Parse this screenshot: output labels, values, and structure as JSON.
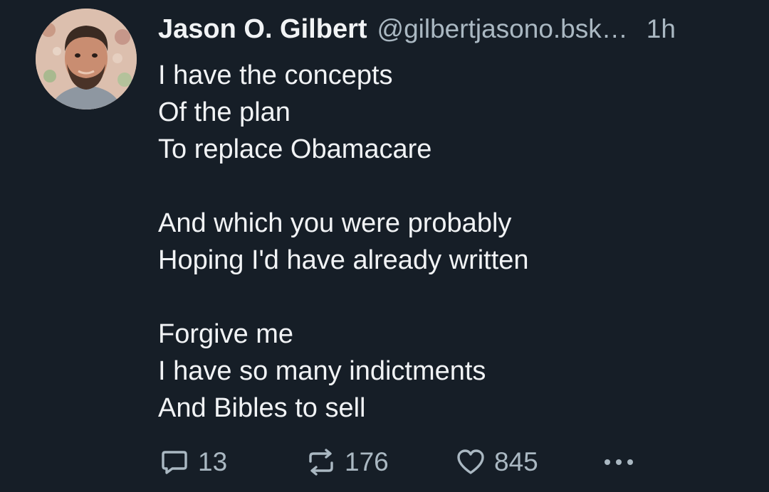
{
  "author": {
    "display_name": "Jason O. Gilbert",
    "handle": "@gilbertjasono.bsk…",
    "time_ago": "1h"
  },
  "post": {
    "lines": [
      "I have the concepts",
      "Of the plan",
      "To replace Obamacare",
      "",
      "And which you were probably",
      "Hoping I'd have already written",
      "",
      "Forgive me",
      "I have so many indictments",
      "And Bibles to sell"
    ]
  },
  "actions": {
    "reply_icon": "reply-bubble-icon",
    "reply_count": "13",
    "repost_icon": "repost-arrows-icon",
    "repost_count": "176",
    "like_icon": "heart-icon",
    "like_count": "845",
    "more_icon": "ellipsis-icon"
  },
  "colors": {
    "background": "#161e27",
    "primary_text": "#f1f3f5",
    "secondary_text": "#aab8c2"
  }
}
